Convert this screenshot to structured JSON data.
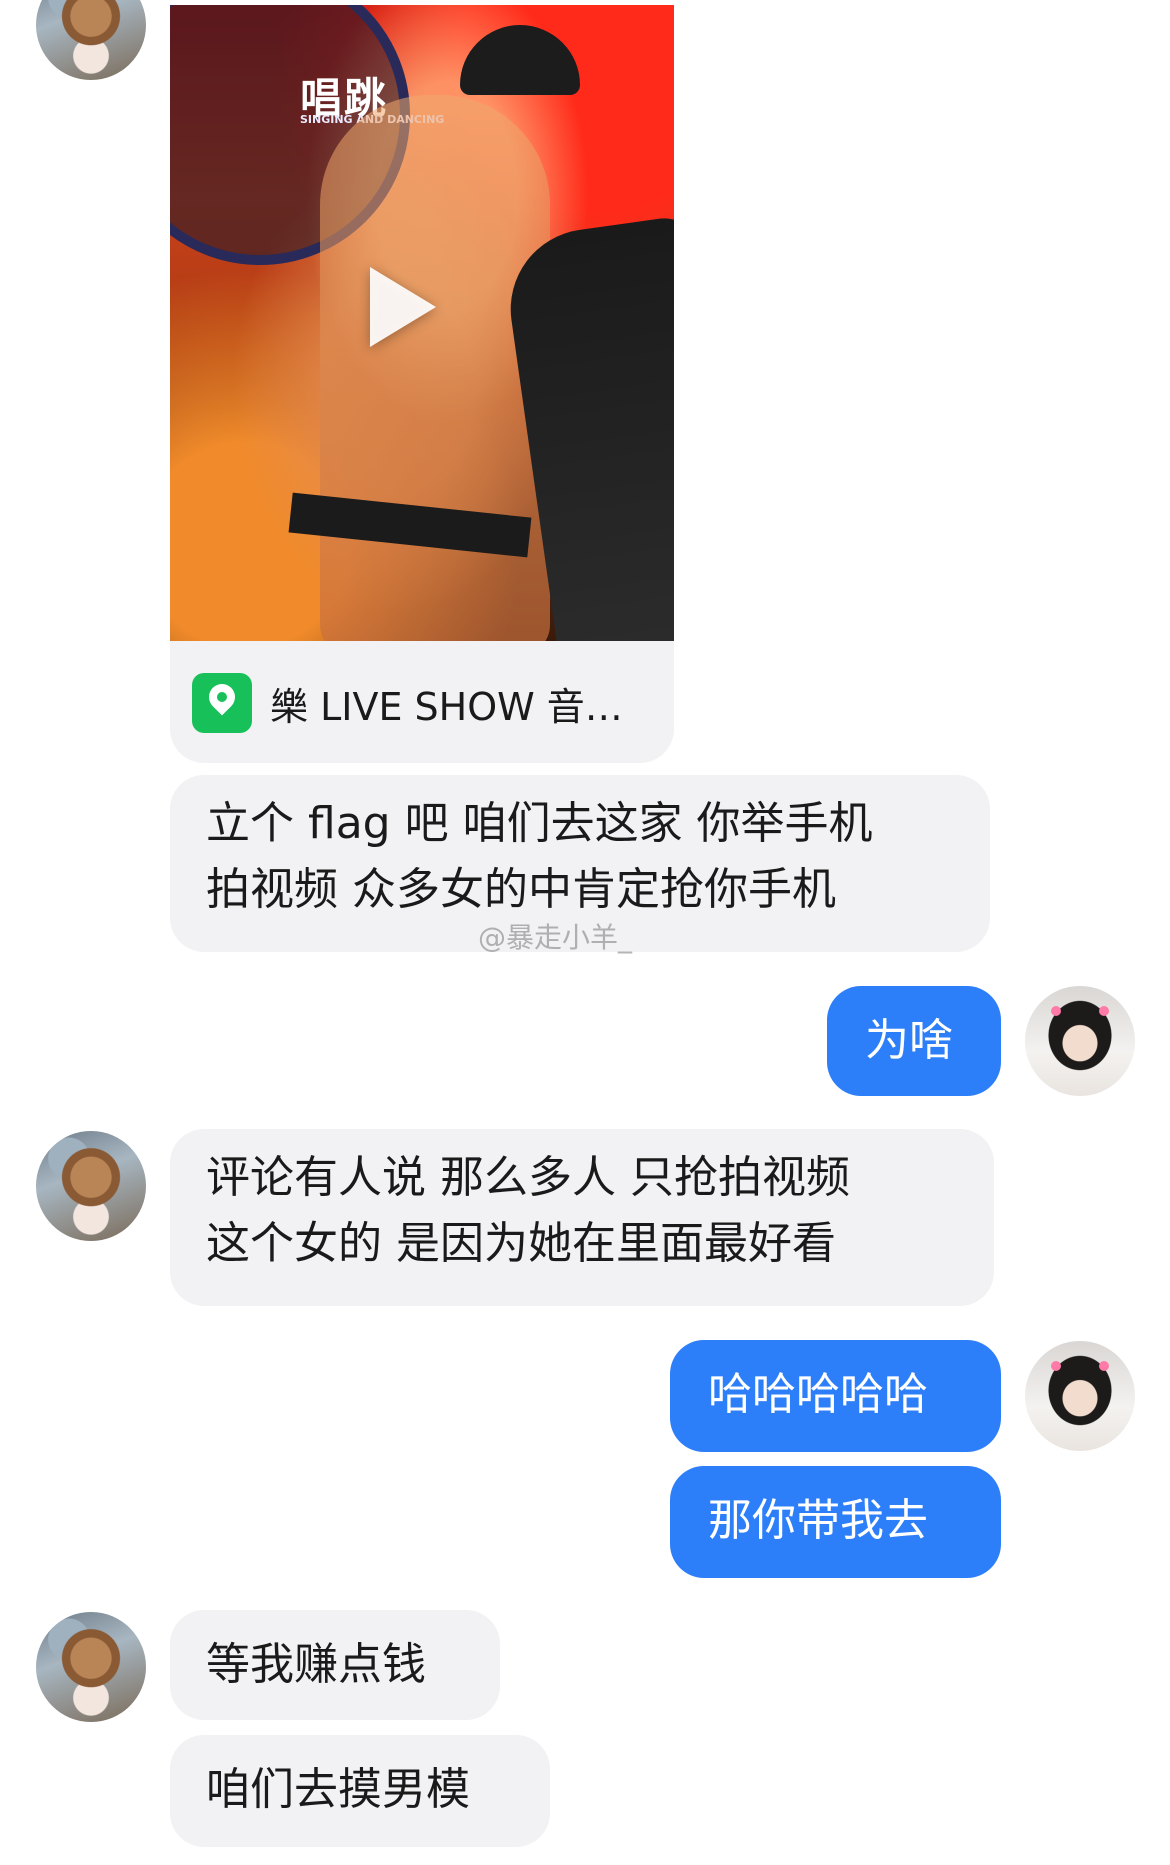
{
  "video_card": {
    "thumbnail_logo_text": "唱跳",
    "thumbnail_logo_subtext": "SINGING AND DANCING",
    "location_label": "樂 LIVE SHOW 音…"
  },
  "messages": [
    {
      "side": "in",
      "text_line1": "立个 flag 吧  咱们去这家  你举手机",
      "text_line2": "拍视频  众多女的中肯定抢你手机"
    },
    {
      "side": "out",
      "text": "为啥"
    },
    {
      "side": "in",
      "text_line1": "评论有人说  那么多人  只抢拍视频",
      "text_line2": "这个女的  是因为她在里面最好看"
    },
    {
      "side": "out",
      "text": "哈哈哈哈哈"
    },
    {
      "side": "out",
      "text": "那你带我去"
    },
    {
      "side": "in",
      "text": "等我赚点钱"
    },
    {
      "side": "in",
      "text": "咱们去摸男模"
    }
  ],
  "watermark": "@暴走小羊_",
  "colors": {
    "outgoing_bubble": "#2d7ff9",
    "incoming_bubble": "#f2f2f4",
    "location_icon": "#18c05a"
  }
}
